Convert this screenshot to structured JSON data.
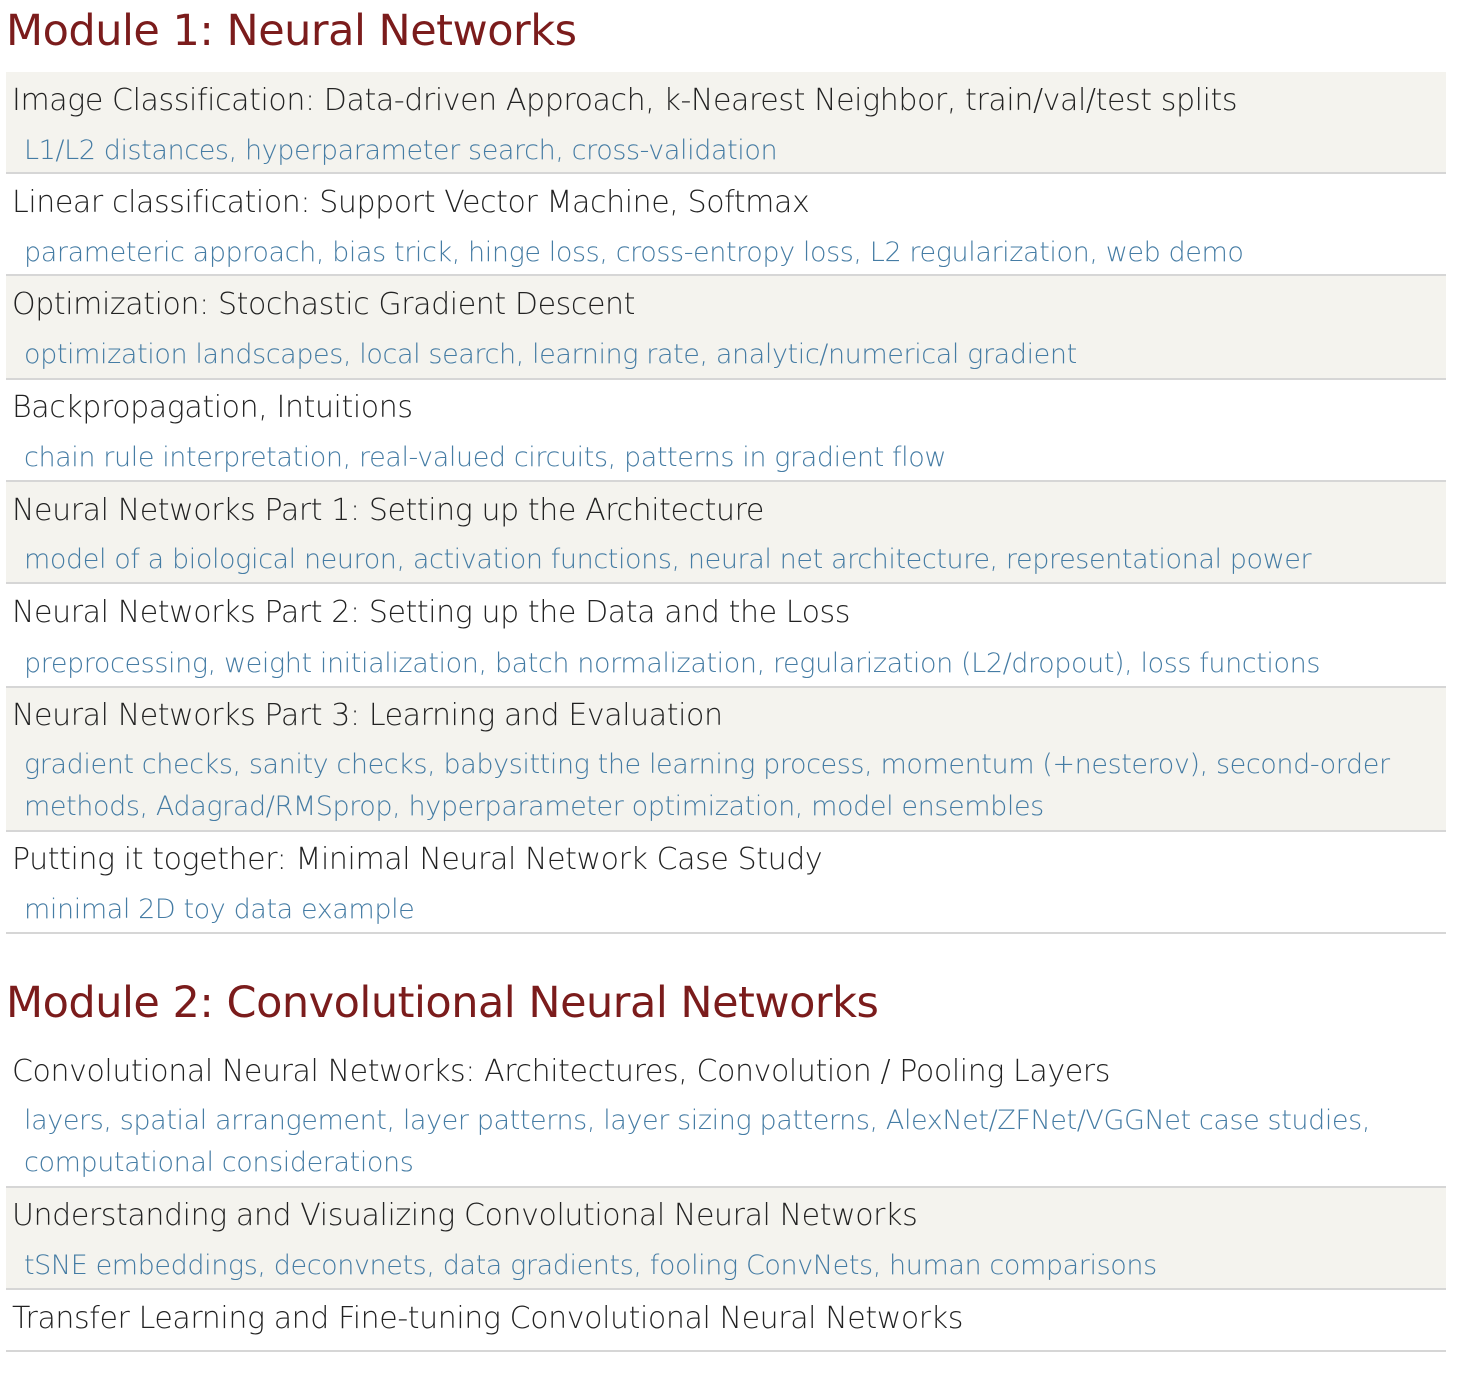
{
  "modules": [
    {
      "title": "Module 1: Neural Networks",
      "items": [
        {
          "title": "Image Classification: Data-driven Approach, k-Nearest Neighbor, train/val/test splits",
          "desc": "L1/L2 distances, hyperparameter search, cross-validation"
        },
        {
          "title": "Linear classification: Support Vector Machine, Softmax",
          "desc": "parameteric approach, bias trick, hinge loss, cross-entropy loss, L2 regularization, web demo"
        },
        {
          "title": "Optimization: Stochastic Gradient Descent",
          "desc": "optimization landscapes, local search, learning rate, analytic/numerical gradient"
        },
        {
          "title": "Backpropagation, Intuitions",
          "desc": "chain rule interpretation, real-valued circuits, patterns in gradient flow"
        },
        {
          "title": "Neural Networks Part 1: Setting up the Architecture",
          "desc": "model of a biological neuron, activation functions, neural net architecture, representational power"
        },
        {
          "title": "Neural Networks Part 2: Setting up the Data and the Loss",
          "desc": "preprocessing, weight initialization, batch normalization, regularization (L2/dropout), loss functions"
        },
        {
          "title": "Neural Networks Part 3: Learning and Evaluation",
          "desc": "gradient checks, sanity checks, babysitting the learning process, momentum (+nesterov), second-order methods, Adagrad/RMSprop, hyperparameter optimization, model ensembles"
        },
        {
          "title": "Putting it together: Minimal Neural Network Case Study",
          "desc": "minimal 2D toy data example"
        }
      ]
    },
    {
      "title": "Module 2: Convolutional Neural Networks",
      "items": [
        {
          "title": "Convolutional Neural Networks: Architectures, Convolution / Pooling Layers",
          "desc": "layers, spatial arrangement, layer patterns, layer sizing patterns, AlexNet/ZFNet/VGGNet case studies, computational considerations"
        },
        {
          "title": "Understanding and Visualizing Convolutional Neural Networks",
          "desc": "tSNE embeddings, deconvnets, data gradients, fooling ConvNets, human comparisons"
        },
        {
          "title": "Transfer Learning and Fine-tuning Convolutional Neural Networks",
          "desc": ""
        }
      ]
    }
  ]
}
